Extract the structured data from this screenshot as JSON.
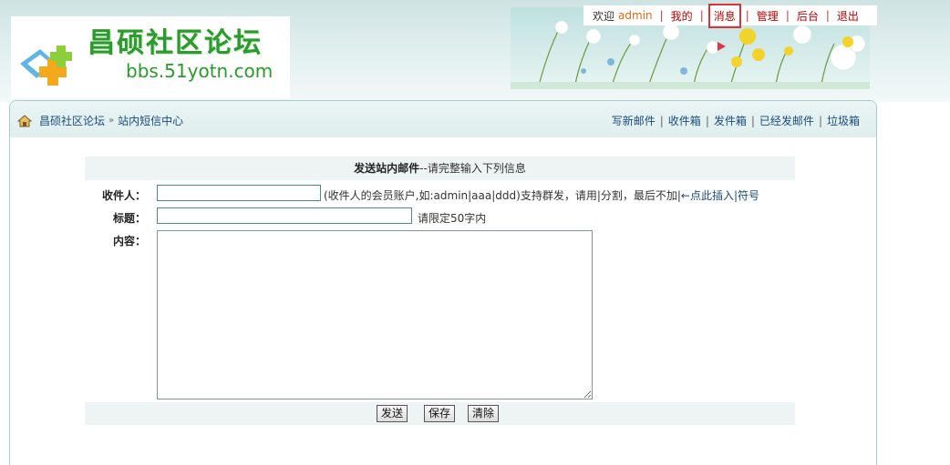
{
  "header": {
    "logo_title": "昌硕社区论坛",
    "logo_url": "bbs.51yotn.com",
    "topnav": {
      "welcome": "欢迎",
      "username": "admin",
      "items": [
        "我的",
        "消息",
        "管理",
        "后台",
        "退出"
      ],
      "separator": "|"
    },
    "colors": {
      "nav_link": "#c00000",
      "username": "#e06a10",
      "highlight_box": "#d9343a"
    }
  },
  "breadcrumb": {
    "home_icon": "home-icon",
    "items": [
      "昌硕社区论坛",
      "站内短信中心"
    ],
    "arrow": "»"
  },
  "mail_nav": {
    "items": [
      "写新邮件",
      "收件箱",
      "发件箱",
      "已经发邮件",
      "垃圾箱"
    ],
    "separator": "|"
  },
  "form": {
    "heading_bold": "发送站内邮件",
    "heading_rest": "--请完整输入下列信息",
    "recipient": {
      "label": "收件人：",
      "value": "",
      "hint": "(收件人的会员账户,如:admin|aaa|ddd)支持群发，请用|分割，最后不加|",
      "insert_link": "←点此插入|符号"
    },
    "subject": {
      "label": "标题：",
      "value": "",
      "hint": "请限定50字内"
    },
    "content": {
      "label": "内容：",
      "value": ""
    },
    "buttons": {
      "send": "发送",
      "save": "保存",
      "clear": "清除"
    }
  }
}
